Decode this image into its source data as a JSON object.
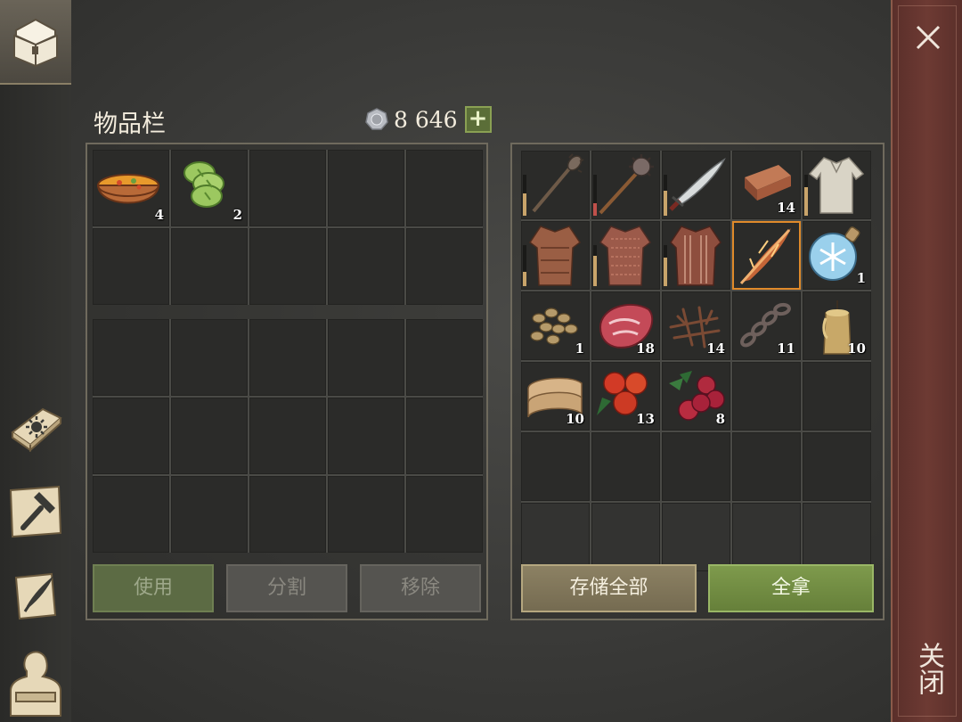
{
  "inventory": {
    "title": "物品栏",
    "currency": {
      "amount": "8 646",
      "plus_label": "+"
    },
    "top_slots": [
      {
        "item": "soup-bowl",
        "count": "4"
      },
      {
        "item": "cucumber-slices",
        "count": "2"
      },
      {
        "item": "",
        "count": ""
      },
      {
        "item": "",
        "count": ""
      },
      {
        "item": "",
        "count": ""
      },
      {
        "item": "",
        "count": ""
      },
      {
        "item": "",
        "count": ""
      },
      {
        "item": "",
        "count": ""
      },
      {
        "item": "",
        "count": ""
      },
      {
        "item": "",
        "count": ""
      }
    ],
    "buttons": {
      "use": "使用",
      "split": "分割",
      "remove": "移除"
    }
  },
  "container": {
    "slots": [
      {
        "item": "spiked-mace",
        "count": "",
        "durability": 0.55,
        "dur_color": "#c9a46a"
      },
      {
        "item": "morning-star",
        "count": "",
        "durability": 0.3,
        "dur_color": "#c0504a"
      },
      {
        "item": "saber",
        "count": "",
        "durability": 0.6,
        "dur_color": "#c9a46a"
      },
      {
        "item": "copper-ingot",
        "count": "14"
      },
      {
        "item": "cloth-shirt",
        "count": "",
        "durability": 0.7,
        "dur_color": "#c9a46a"
      },
      {
        "item": "leather-armor",
        "count": "",
        "durability": 0.35,
        "dur_color": "#c9a46a"
      },
      {
        "item": "chainmail-shirt",
        "count": "",
        "durability": 0.75,
        "dur_color": "#c9a46a"
      },
      {
        "item": "padded-gambeson",
        "count": "",
        "durability": 0.7,
        "dur_color": "#c9a46a"
      },
      {
        "item": "flaming-spear",
        "count": "",
        "selected": true
      },
      {
        "item": "frost-potion",
        "count": "1"
      },
      {
        "item": "seeds",
        "count": "1"
      },
      {
        "item": "raw-meat",
        "count": "18"
      },
      {
        "item": "twigs",
        "count": "14"
      },
      {
        "item": "chain",
        "count": "11"
      },
      {
        "item": "candle",
        "count": "10"
      },
      {
        "item": "fabric-roll",
        "count": "10"
      },
      {
        "item": "red-berries",
        "count": "13"
      },
      {
        "item": "cranberries",
        "count": "8"
      },
      {
        "item": "",
        "count": ""
      },
      {
        "item": "",
        "count": ""
      },
      {
        "item": "",
        "count": ""
      },
      {
        "item": "",
        "count": ""
      },
      {
        "item": "",
        "count": ""
      },
      {
        "item": "",
        "count": ""
      },
      {
        "item": "",
        "count": ""
      },
      {
        "item": "",
        "count": ""
      },
      {
        "item": "",
        "count": ""
      },
      {
        "item": "",
        "count": ""
      },
      {
        "item": "",
        "count": ""
      },
      {
        "item": "",
        "count": ""
      }
    ],
    "buttons": {
      "store_all": "存储全部",
      "take_all": "全拿"
    }
  },
  "sidebar": {
    "items": [
      {
        "icon": "chest-icon"
      },
      {
        "icon": "sun-book-icon"
      },
      {
        "icon": "crafting-hammer-icon"
      },
      {
        "icon": "quill-scroll-icon"
      },
      {
        "icon": "character-icon"
      }
    ]
  },
  "close": {
    "label": "关闭",
    "icon": "close-icon"
  },
  "colors": {
    "accent_green": "#7e9a4c",
    "selected_border": "#e08a2a",
    "close_bar": "#6d3a33"
  }
}
